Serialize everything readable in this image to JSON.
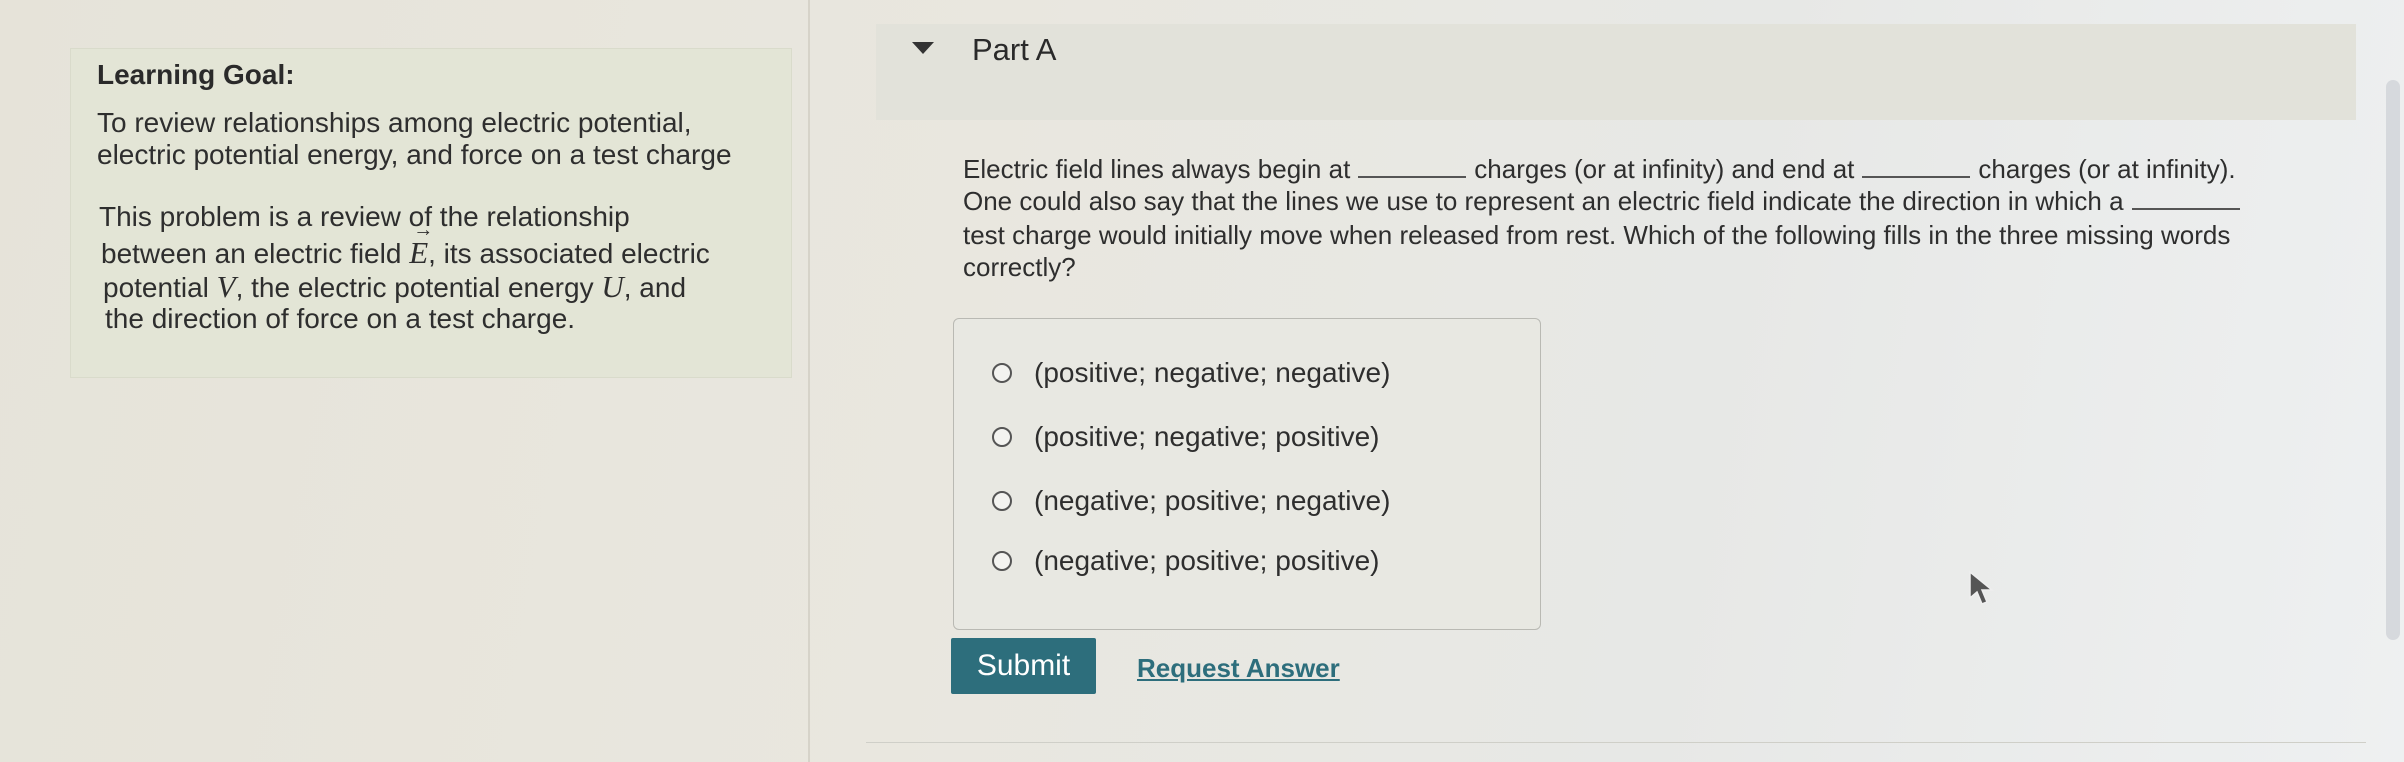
{
  "learning_goal": {
    "title": "Learning Goal:",
    "lines": [
      "To review relationships among electric potential,",
      "electric potential energy, and force on a test charge"
    ]
  },
  "description": {
    "line1": "This problem is a review of the relationship",
    "line2_pre": "between an electric field ",
    "line2_sym": "E",
    "line2_post": ", its associated electric",
    "line3_pre": "potential ",
    "line3_sym1": "V",
    "line3_mid": ", the electric potential energy ",
    "line3_sym2": "U",
    "line3_post": ", and",
    "line4": "the direction of force on a test charge."
  },
  "part": {
    "title": "Part A"
  },
  "question": {
    "l1_a": "Electric field lines always begin at",
    "l1_b": "charges (or at infinity) and end at",
    "l1_c": "charges (or at infinity).",
    "l2": "One could also say that the lines we use to represent an electric field indicate the direction in which a",
    "l3": "test charge would initially move when released from rest. Which of the following fills in the three missing words",
    "l4": "correctly?"
  },
  "options": [
    "(positive; negative; negative)",
    "(positive; negative; positive)",
    "(negative; positive; negative)",
    "(negative; positive; positive)"
  ],
  "actions": {
    "submit": "Submit",
    "request_answer": "Request Answer"
  },
  "colors": {
    "accent": "#2d6e7c",
    "panel": "#e3e5d6"
  }
}
